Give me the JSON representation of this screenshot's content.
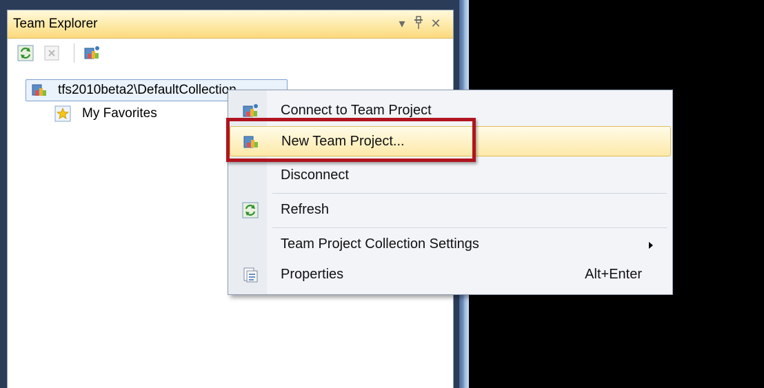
{
  "window": {
    "title": "Team Explorer",
    "dropdown_glyph": "▾",
    "pin_glyph": "ᛘ",
    "close_glyph": "✕"
  },
  "toolbar": {
    "buttons": [
      {
        "icon": "refresh-icon"
      },
      {
        "icon": "stop-icon"
      },
      {
        "icon": "connect-team-project-icon"
      }
    ]
  },
  "tree": {
    "collection": {
      "label": "tfs2010beta2\\DefaultCollection",
      "icon": "team-collection-icon"
    },
    "favorites": {
      "label": "My Favorites",
      "icon": "favorites-star-icon"
    }
  },
  "context_menu": {
    "items": [
      {
        "label": "Connect to Team Project",
        "icon": "connect-team-project-icon"
      },
      {
        "label": "New Team Project...",
        "icon": "new-team-project-icon",
        "highlighted": true
      },
      {
        "label": "Disconnect"
      },
      {
        "label": "Refresh",
        "icon": "refresh-icon"
      },
      {
        "label": "Team Project Collection Settings",
        "submenu": true
      },
      {
        "label": "Properties",
        "icon": "properties-icon",
        "shortcut": "Alt+Enter"
      }
    ]
  },
  "colors": {
    "highlight_box": "#b0141e",
    "title_bar": "#fde9a6",
    "menu_hover": "#fde9a8"
  }
}
